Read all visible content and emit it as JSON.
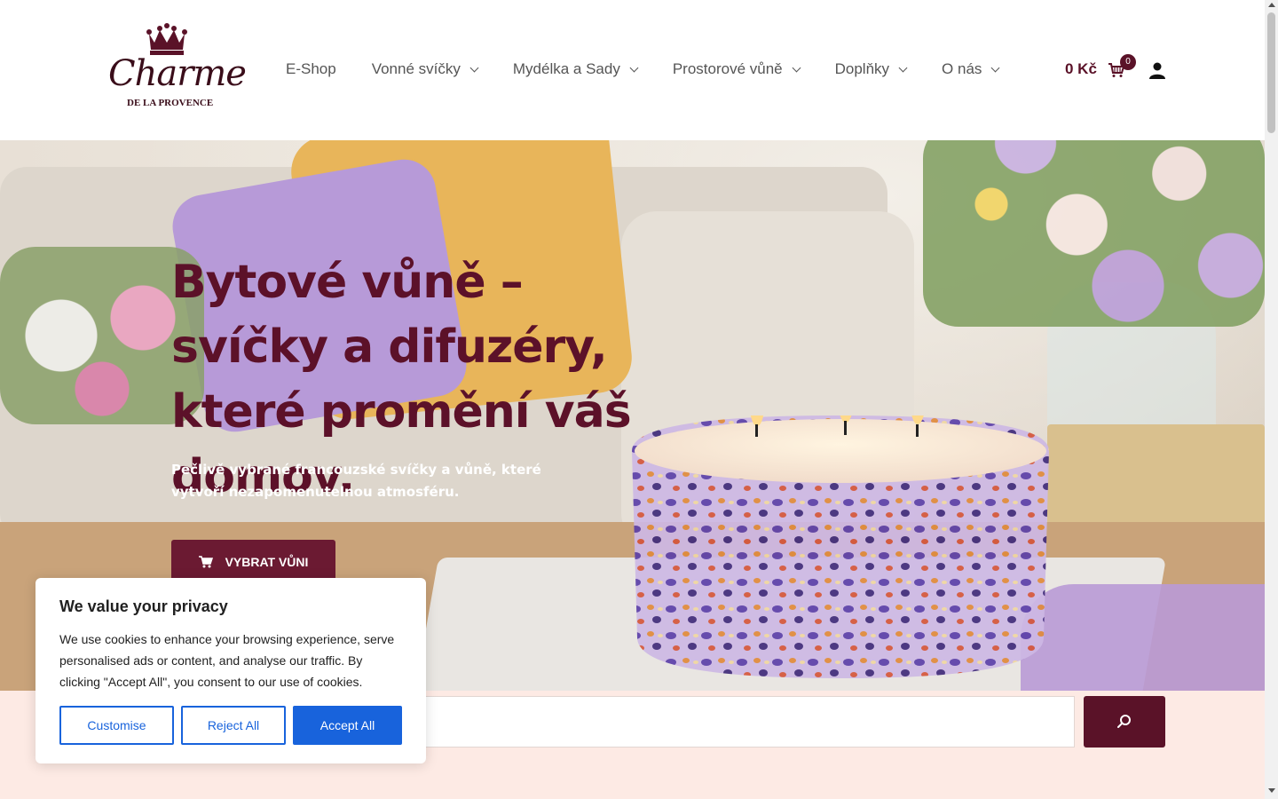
{
  "header": {
    "logo_script": "Charme",
    "logo_sub": "DE LA PROVENCE",
    "nav": [
      {
        "label": "E-Shop",
        "has_dropdown": false
      },
      {
        "label": "Vonné svíčky",
        "has_dropdown": true
      },
      {
        "label": "Mydélka a Sady",
        "has_dropdown": true
      },
      {
        "label": "Prostorové vůně",
        "has_dropdown": true
      },
      {
        "label": "Doplňky",
        "has_dropdown": true
      },
      {
        "label": "O nás",
        "has_dropdown": true
      }
    ],
    "cart_total": "0 Kč",
    "cart_count": "0",
    "icons": {
      "cart": "cart-icon",
      "user": "user-icon",
      "crown": "crown-icon",
      "chevron": "chevron-down-icon"
    }
  },
  "hero": {
    "title": "Bytové vůně – svíčky a difuzéry, které promění váš domov.",
    "subtitle": "Pečlivě vybrané francouzské svíčky a vůně, které vytvoří nezapomenutelnou atmosféru.",
    "button_label": "VYBRAT VŮNI"
  },
  "search": {
    "value": "",
    "placeholder": "",
    "icon": "search-icon"
  },
  "cookie": {
    "title": "We value your privacy",
    "text": "We use cookies to enhance your browsing experience, serve personalised ads or content, and analyse our traffic. By clicking \"Accept All\", you consent to our use of cookies.",
    "customise": "Customise",
    "reject": "Reject All",
    "accept": "Accept All"
  },
  "colors": {
    "brand": "#5a1228",
    "cookie_accent": "#1863dc",
    "band": "#fdeae4"
  }
}
